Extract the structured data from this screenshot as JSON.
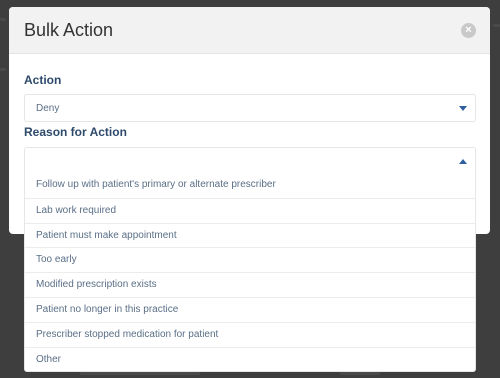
{
  "modal": {
    "title": "Bulk Action",
    "close_symbol": "×"
  },
  "action": {
    "label": "Action",
    "value": "Deny"
  },
  "reason": {
    "label": "Reason for Action",
    "value": "",
    "options": [
      "Follow up with patient's primary or alternate prescriber",
      "Lab work required",
      "Patient must make appointment",
      "Too early",
      "Modified prescription exists",
      "Patient no longer in this practice",
      "Prescriber stopped medication for patient",
      "Other"
    ]
  },
  "colors": {
    "label": "#2d4a6b",
    "caret": "#2f5f9e",
    "option_text": "#5a6f86"
  }
}
